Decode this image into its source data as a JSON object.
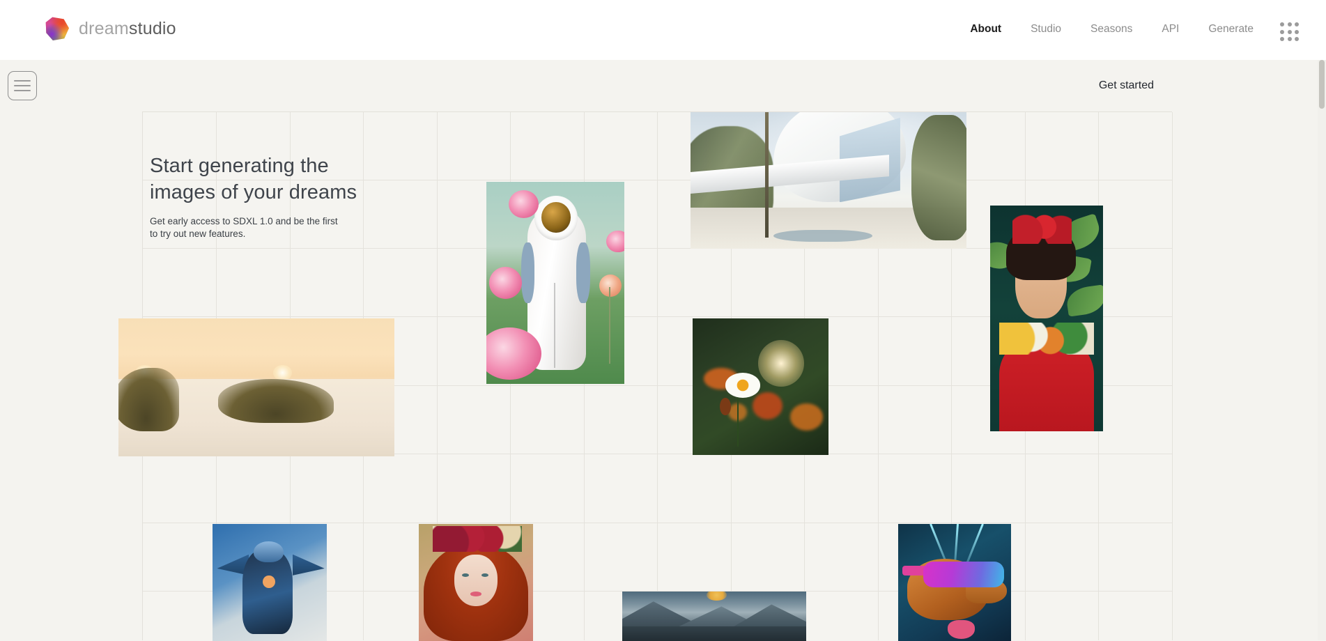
{
  "brand": {
    "part1": "dream",
    "part2": "studio",
    "logo_icon": "hexagon-gradient-icon"
  },
  "nav": {
    "items": [
      {
        "label": "About",
        "active": true
      },
      {
        "label": "Studio",
        "active": false
      },
      {
        "label": "Seasons",
        "active": false
      },
      {
        "label": "API",
        "active": false
      },
      {
        "label": "Generate",
        "active": false
      }
    ],
    "apps_icon": "grid-dots-icon"
  },
  "subbar": {
    "menu_icon": "hamburger-menu-icon",
    "get_started_label": "Get started"
  },
  "hero": {
    "heading_line1": "Start generating the",
    "heading_line2": "images of your dreams",
    "subtext": "Get early access to SDXL 1.0 and be the first to try out new features."
  },
  "colors": {
    "page_background": "#f4f3ef",
    "header_background": "#ffffff",
    "grid_line": "#e4e2dc",
    "nav_active": "#1b1b1b",
    "nav_inactive": "#8c8c8c",
    "heading_text": "#3f444b"
  },
  "gallery": {
    "columns": 14,
    "rows": 7,
    "tiles": [
      {
        "name": "architecture-render",
        "alt": "White curved modern house among trees"
      },
      {
        "name": "astronaut-roses",
        "alt": "Astronaut standing in a garden of pink roses"
      },
      {
        "name": "beach-dunes-sunset",
        "alt": "Sand dunes with grass at sunset by the sea"
      },
      {
        "name": "daisy-sunset-field",
        "alt": "White daisy in a field of orange flowers at sunset"
      },
      {
        "name": "frida-portrait",
        "alt": "Woman with red flowers in hair and floral red dress"
      },
      {
        "name": "blue-alien-warrior",
        "alt": "Blue armored sci-fi alien figure"
      },
      {
        "name": "red-haired-queen",
        "alt": "Red haired woman wearing a flower crown"
      },
      {
        "name": "mountain-landscape",
        "alt": "Misty mountain range at sunrise"
      },
      {
        "name": "vr-dog",
        "alt": "Dog wearing neon virtual reality goggles"
      }
    ]
  }
}
